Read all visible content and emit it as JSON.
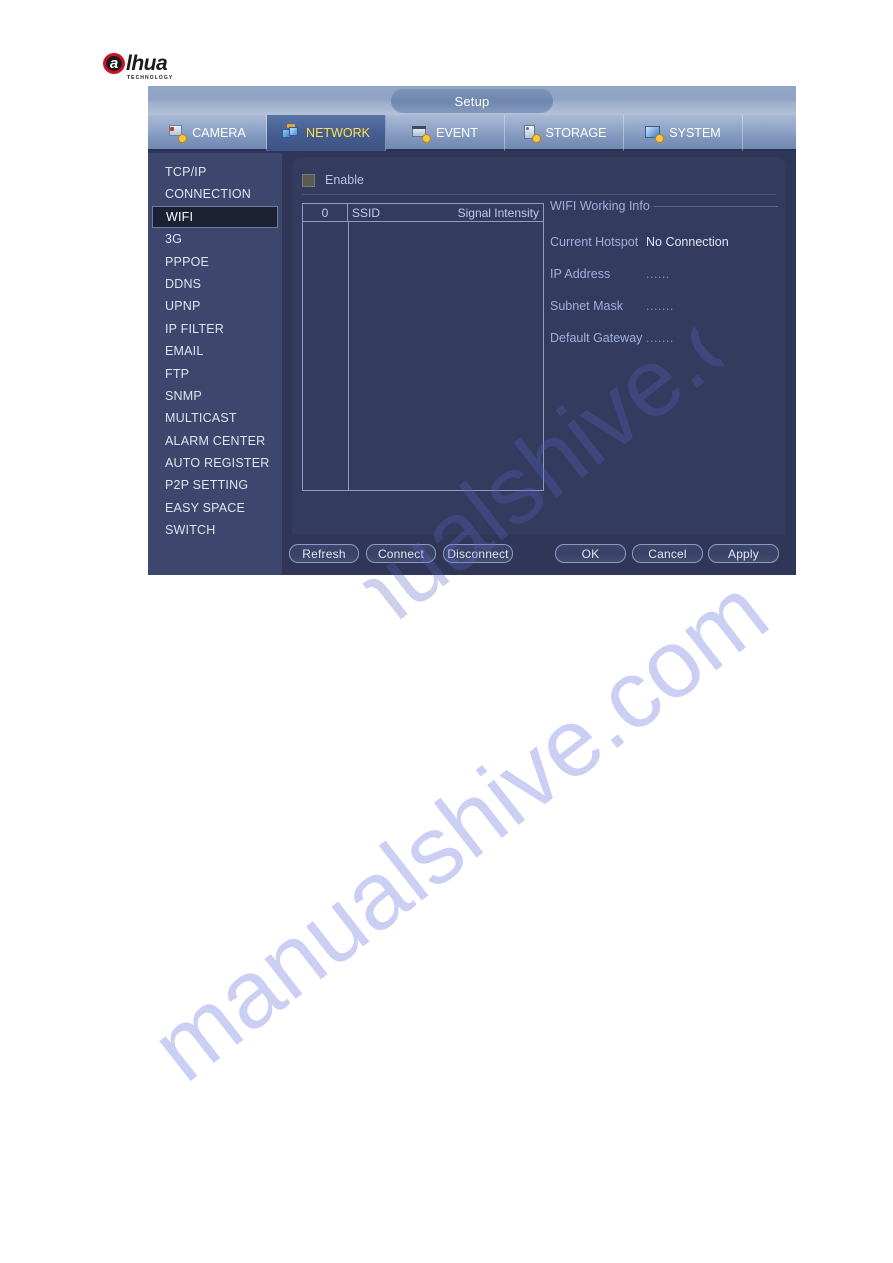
{
  "brand": {
    "logo_letter": "a",
    "logo_word": "lhua",
    "logo_tagline": "TECHNOLOGY"
  },
  "dialog": {
    "title": "Setup"
  },
  "tabs": [
    {
      "label": "CAMERA",
      "icon": "camera-gear-icon",
      "active": false
    },
    {
      "label": "NETWORK",
      "icon": "network-gear-icon",
      "active": true
    },
    {
      "label": "EVENT",
      "icon": "event-gear-icon",
      "active": false
    },
    {
      "label": "STORAGE",
      "icon": "storage-gear-icon",
      "active": false
    },
    {
      "label": "SYSTEM",
      "icon": "system-gear-icon",
      "active": false
    }
  ],
  "sidebar": {
    "items": [
      {
        "label": "TCP/IP",
        "active": false
      },
      {
        "label": "CONNECTION",
        "active": false
      },
      {
        "label": "WIFI",
        "active": true
      },
      {
        "label": "3G",
        "active": false
      },
      {
        "label": "PPPOE",
        "active": false
      },
      {
        "label": "DDNS",
        "active": false
      },
      {
        "label": "UPNP",
        "active": false
      },
      {
        "label": "IP FILTER",
        "active": false
      },
      {
        "label": "EMAIL",
        "active": false
      },
      {
        "label": "FTP",
        "active": false
      },
      {
        "label": "SNMP",
        "active": false
      },
      {
        "label": "MULTICAST",
        "active": false
      },
      {
        "label": "ALARM CENTER",
        "active": false
      },
      {
        "label": "AUTO REGISTER",
        "active": false
      },
      {
        "label": "P2P SETTING",
        "active": false
      },
      {
        "label": "EASY SPACE",
        "active": false
      },
      {
        "label": "SWITCH",
        "active": false
      }
    ]
  },
  "main": {
    "enable": {
      "label": "Enable",
      "checked": false
    },
    "ssid_table": {
      "columns": {
        "index": "0",
        "ssid": "SSID",
        "signal": "Signal Intensity"
      },
      "rows": []
    },
    "wifi_info": {
      "title": "WIFI Working Info",
      "fields": [
        {
          "label": "Current Hotspot",
          "value": "No Connection"
        },
        {
          "label": "IP Address",
          "value": "......"
        },
        {
          "label": "Subnet Mask",
          "value": "......."
        },
        {
          "label": "Default Gateway",
          "value": "......."
        }
      ]
    }
  },
  "buttons": {
    "refresh": "Refresh",
    "connect": "Connect",
    "disconnect": "Disconnect",
    "ok": "OK",
    "cancel": "Cancel",
    "apply": "Apply"
  },
  "watermark": {
    "text": "manualshive.com"
  },
  "colors": {
    "dialog_bg": "#2f3658",
    "sidebar_bg": "#3d466c",
    "accent_selected_tab_text": "#ffe14d",
    "label_text": "#9fb0db",
    "value_text": "#dfe6f6",
    "logo_red": "#cf102d"
  }
}
